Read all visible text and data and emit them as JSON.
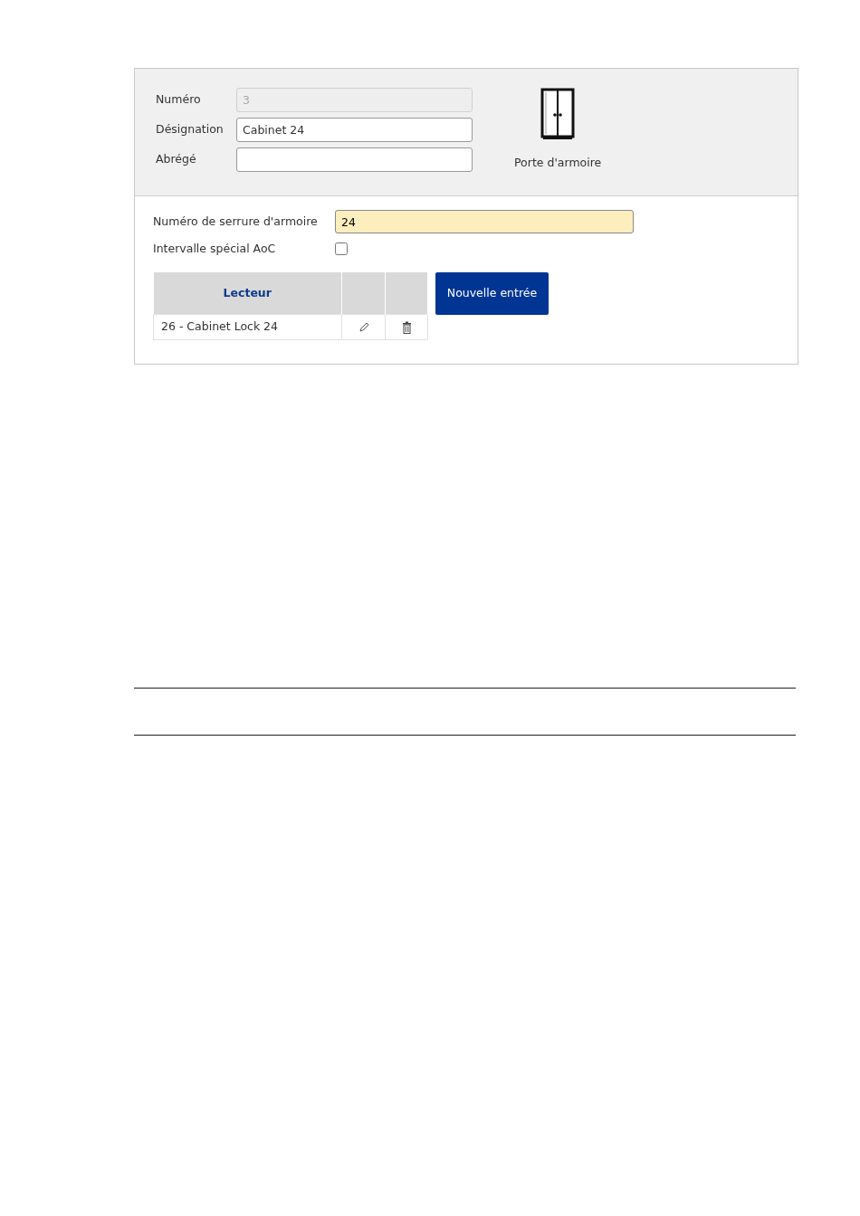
{
  "header_fields": [
    {
      "label": "Numéro",
      "value": "3",
      "disabled": true
    },
    {
      "label": "Désignation",
      "value": "Cabinet 24",
      "disabled": false
    },
    {
      "label": "Abrégé",
      "disabled": false
    }
  ],
  "door_type": {
    "label": "Porte d'armoire"
  },
  "lock_number": {
    "label": "Numéro de serrure d'armoire",
    "value": "24",
    "highlighted": true
  },
  "special_interval": {
    "label": "Intervalle spécial AoC",
    "checked": false
  },
  "readers_table": {
    "columns": [
      "Lecteur"
    ],
    "rows": [
      {
        "reader": "26 - Cabinet Lock 24"
      }
    ]
  },
  "new_entry_button": "Nouvelle entrée"
}
